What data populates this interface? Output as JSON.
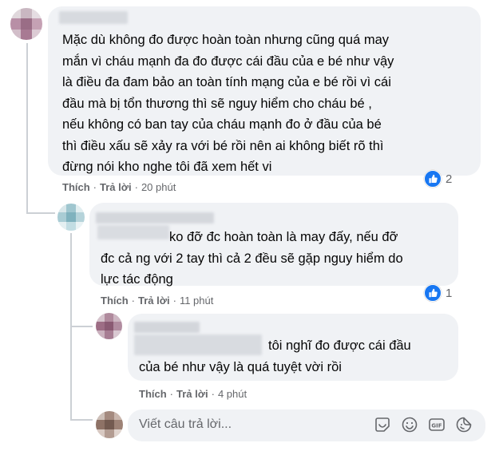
{
  "comments": [
    {
      "text": "Mặc dù không đo được hoàn toàn nhưng cũng quá may\nmắn vì cháu mạnh đa đo được cái đầu của e bé như vậy\nlà điều đa đam bảo an toàn tính mạng của e bé rồi vì cái\nđầu mà bị tổn thương thì sẽ nguy hiểm cho cháu bé ,\nnếu không có ban tay của cháu mạnh đo ở đầu của bé\nthì điều xấu sẽ xảy ra với bé rồi nên ai không biết rõ thì\nđừng nói kho nghe tôi đã xem hết vi",
      "like_label": "Thích",
      "reply_label": "Trả lời",
      "time": "20 phút",
      "reaction_count": "2"
    },
    {
      "text": "ko đỡ đc hoàn toàn là may đấy, nếu đỡ\nđc cả ng với 2 tay thì cả 2 đều sẽ gặp nguy hiểm do\nlực tác động",
      "like_label": "Thích",
      "reply_label": "Trả lời",
      "time": "11 phút",
      "reaction_count": "1"
    },
    {
      "text": "tôi nghĩ đo được cái đầu\ncủa bé như vậy là quá tuyệt vời rồi",
      "like_label": "Thích",
      "reply_label": "Trả lời",
      "time": "4 phút"
    }
  ],
  "reply_box": {
    "placeholder": "Viết câu trả lời..."
  },
  "icons": [
    "like-icon",
    "sticker-icon",
    "emoji-icon",
    "gif-icon",
    "sticker-face-icon"
  ],
  "colors": {
    "bubble": "#f0f2f5",
    "like_blue": "#1877f2",
    "meta_gray": "#65676b",
    "thread_line": "#ccd0d5"
  }
}
